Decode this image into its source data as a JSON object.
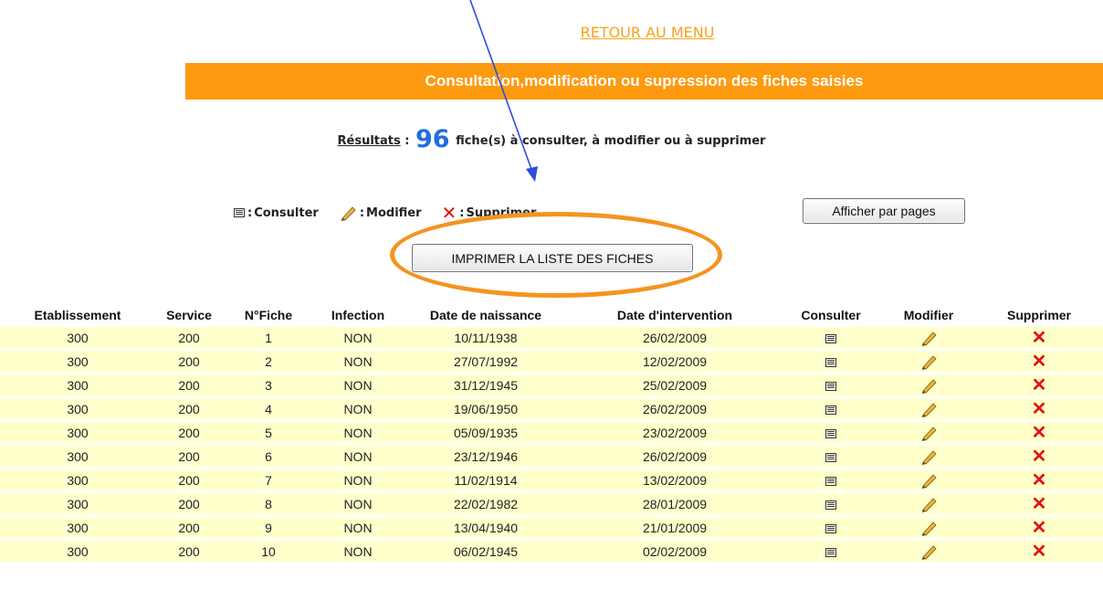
{
  "nav": {
    "menu_link": "RETOUR AU MENU"
  },
  "banner": {
    "title": "Consultation,modification ou supression des fiches saisies"
  },
  "results": {
    "label": "Résultats",
    "colon": " :",
    "count": "96",
    "text": "fiche(s) à consulter, à modifier ou à supprimer"
  },
  "legend": {
    "consult_label": "Consulter",
    "edit_label": "Modifier",
    "delete_label": "Supprimer",
    "separator": ":"
  },
  "buttons": {
    "pages": "Afficher par pages",
    "print": "IMPRIMER LA LISTE DES FICHES"
  },
  "colors": {
    "accent": "#fd9a0f",
    "link": "#f7a21a",
    "row": "#ffffcc",
    "count": "#1f6fe0",
    "delete": "#e3120b",
    "arrow": "#2b4ce0"
  },
  "table": {
    "headers": [
      "Etablissement",
      "Service",
      "N°Fiche",
      "Infection",
      "Date de naissance",
      "Date d'intervention",
      "Consulter",
      "Modifier",
      "Supprimer"
    ],
    "rows": [
      [
        "300",
        "200",
        "1",
        "NON",
        "10/11/1938",
        "26/02/2009"
      ],
      [
        "300",
        "200",
        "2",
        "NON",
        "27/07/1992",
        "12/02/2009"
      ],
      [
        "300",
        "200",
        "3",
        "NON",
        "31/12/1945",
        "25/02/2009"
      ],
      [
        "300",
        "200",
        "4",
        "NON",
        "19/06/1950",
        "26/02/2009"
      ],
      [
        "300",
        "200",
        "5",
        "NON",
        "05/09/1935",
        "23/02/2009"
      ],
      [
        "300",
        "200",
        "6",
        "NON",
        "23/12/1946",
        "26/02/2009"
      ],
      [
        "300",
        "200",
        "7",
        "NON",
        "11/02/1914",
        "13/02/2009"
      ],
      [
        "300",
        "200",
        "8",
        "NON",
        "22/02/1982",
        "28/01/2009"
      ],
      [
        "300",
        "200",
        "9",
        "NON",
        "13/04/1940",
        "21/01/2009"
      ],
      [
        "300",
        "200",
        "10",
        "NON",
        "06/02/1945",
        "02/02/2009"
      ]
    ],
    "row_icons": [
      "consult-icon",
      "pencil-icon",
      "delete-x-icon"
    ]
  }
}
